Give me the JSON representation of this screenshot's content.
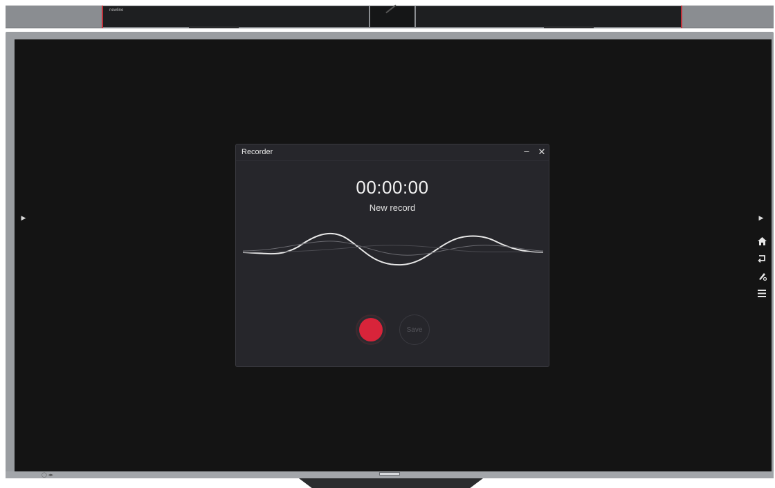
{
  "device": {
    "top_bar_brand": "newline"
  },
  "recorder": {
    "title": "Recorder",
    "minimize_label": "–",
    "close_label": "✕",
    "timer": "00:00:00",
    "status": "New record",
    "save_label": "Save",
    "accent_color": "#d8243a"
  },
  "side_toolbar": {
    "items": [
      {
        "icon": "home-icon"
      },
      {
        "icon": "back-icon"
      },
      {
        "icon": "annotate-icon"
      },
      {
        "icon": "menu-icon"
      }
    ]
  }
}
